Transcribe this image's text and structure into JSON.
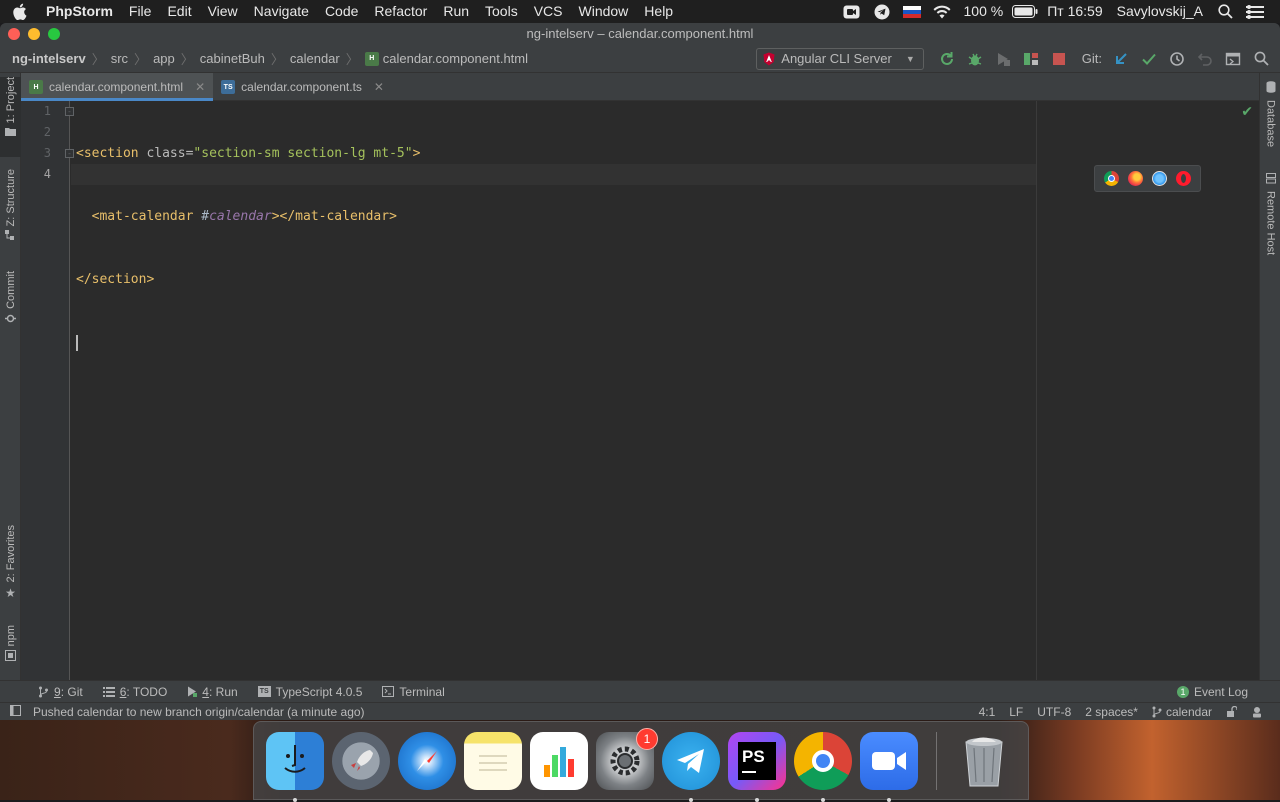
{
  "menubar": {
    "app_name": "PhpStorm",
    "items": [
      "File",
      "Edit",
      "View",
      "Navigate",
      "Code",
      "Refactor",
      "Run",
      "Tools",
      "VCS",
      "Window",
      "Help"
    ],
    "battery": "100 %",
    "clock": "Пт 16:59",
    "user": "Savylovskij_A"
  },
  "window": {
    "title": "ng-intelserv – calendar.component.html"
  },
  "navbar": {
    "crumbs": [
      "ng-intelserv",
      "src",
      "app",
      "cabinetBuh",
      "calendar"
    ],
    "file": "calendar.component.html",
    "run_config": "Angular CLI Server",
    "git_label": "Git:"
  },
  "tabs": [
    {
      "label": "calendar.component.html",
      "icon": "html-file-icon",
      "active": true
    },
    {
      "label": "calendar.component.ts",
      "icon": "ts-file-icon",
      "active": false
    }
  ],
  "left_tool_windows": [
    "1: Project",
    "Z: Structure",
    "Commit",
    "2: Favorites",
    "npm"
  ],
  "right_tool_windows": [
    "Database",
    "Remote Host"
  ],
  "editor": {
    "line_numbers": [
      "1",
      "2",
      "3",
      "4"
    ],
    "lines": [
      {
        "l1": "<section ",
        "attr": "class=",
        "val": "\"section-sm section-lg mt-5\"",
        "l2": ">"
      },
      {
        "indent": "  ",
        "t1": "<mat-calendar ",
        "plain": "#",
        "ref": "calendar",
        "t2": "></mat-calendar>"
      },
      {
        "t1": "</section>"
      }
    ],
    "browsers": [
      "chrome-icon",
      "firefox-icon",
      "safari-icon",
      "opera-icon"
    ]
  },
  "bottom_tools": [
    {
      "num": "9",
      "label": ": Git",
      "icon": "git-branch-icon"
    },
    {
      "num": "6",
      "label": ": TODO",
      "icon": "list-icon"
    },
    {
      "num": "4",
      "label": ": Run",
      "icon": "run-icon"
    },
    {
      "num": "",
      "label": "TypeScript 4.0.5",
      "icon": "ts-icon"
    },
    {
      "num": "",
      "label": "Terminal",
      "icon": "terminal-icon"
    }
  ],
  "event_log": {
    "label": "Event Log",
    "count": "1"
  },
  "status": {
    "message": "Pushed calendar to new branch origin/calendar (a minute ago)",
    "position": "4:1",
    "line_sep": "LF",
    "encoding": "UTF-8",
    "indent": "2 spaces*",
    "branch": "calendar"
  },
  "dock": {
    "apps": [
      "Finder",
      "Launchpad",
      "Safari",
      "Notes",
      "Numbers",
      "System Preferences",
      "Telegram",
      "PhpStorm",
      "Chrome",
      "Zoom",
      "Trash"
    ],
    "system_prefs_badge": "1"
  },
  "colors": {
    "accent": "#4a88c7",
    "tag": "#e8bf6a",
    "string": "#a5c25c",
    "reference": "#9876aa"
  }
}
